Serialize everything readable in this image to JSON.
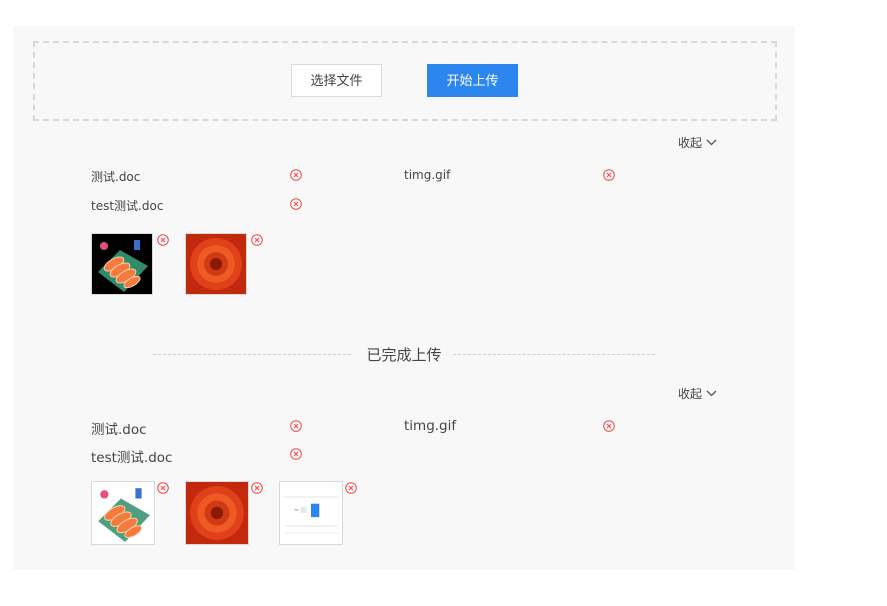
{
  "toolbar": {
    "select_label": "选择文件",
    "upload_label": "开始上传"
  },
  "pending": {
    "collapse_label": "收起",
    "files": [
      "测试.doc",
      "timg.gif",
      "test测试.doc"
    ]
  },
  "divider_label": "已完成上传",
  "completed": {
    "collapse_label": "收起",
    "files": [
      "测试.doc",
      "timg.gif",
      "test测试.doc"
    ]
  },
  "colors": {
    "primary": "#2d86ee",
    "remove": "#ef4b4b",
    "panel_bg": "#f8f8f8"
  },
  "icons": {
    "remove": "close-circle-icon",
    "collapse": "chevron-down-icon"
  }
}
